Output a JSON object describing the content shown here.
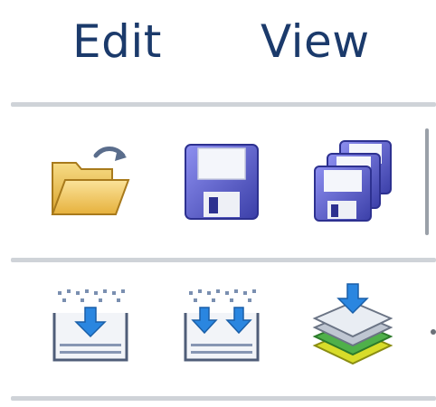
{
  "menu": {
    "edit_label": "Edit",
    "view_label": "View"
  },
  "toolbar": {
    "row1": [
      {
        "icon": "open-folder-icon"
      },
      {
        "icon": "save-disk-icon"
      },
      {
        "icon": "save-all-disks-icon"
      }
    ],
    "row2": [
      {
        "icon": "import-icon"
      },
      {
        "icon": "import-multiple-icon"
      },
      {
        "icon": "import-layers-icon"
      }
    ]
  },
  "colors": {
    "menu_text": "#1b3a6b",
    "divider": "#cfd3d8",
    "folder": "#f2c44c",
    "disk": "#5b5fc7",
    "arrow": "#2a86e0"
  }
}
